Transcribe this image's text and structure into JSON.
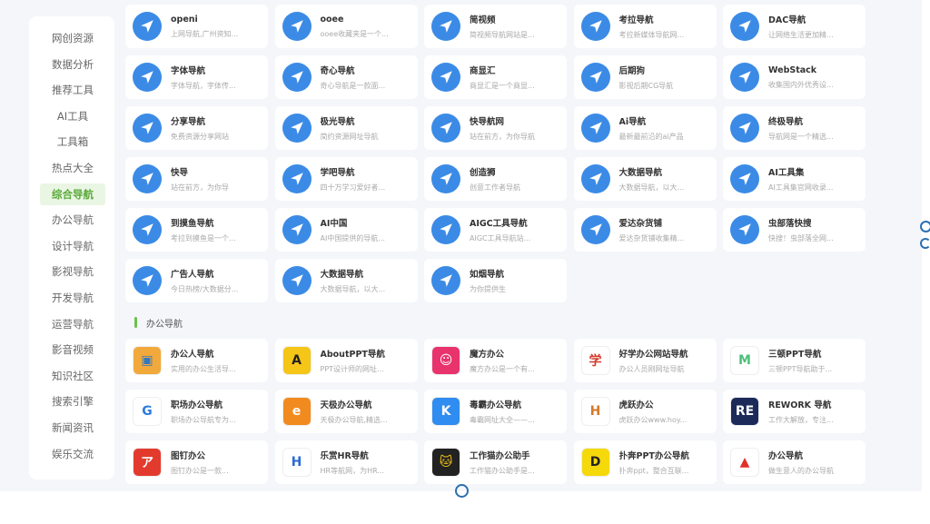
{
  "sidebar": {
    "items": [
      {
        "label": "网创资源"
      },
      {
        "label": "数据分析"
      },
      {
        "label": "推荐工具"
      },
      {
        "label": "AI工具"
      },
      {
        "label": "工具箱"
      },
      {
        "label": "热点大全"
      },
      {
        "label": "综合导航",
        "active": true
      },
      {
        "label": "办公导航"
      },
      {
        "label": "设计导航"
      },
      {
        "label": "影视导航"
      },
      {
        "label": "开发导航"
      },
      {
        "label": "运营导航"
      },
      {
        "label": "影音视频"
      },
      {
        "label": "知识社区"
      },
      {
        "label": "搜索引擎"
      },
      {
        "label": "新闻资讯"
      },
      {
        "label": "娱乐交流"
      }
    ]
  },
  "general_nav": {
    "cards": [
      {
        "title": "openi",
        "desc": "上网导航,广州资知..."
      },
      {
        "title": "ooee",
        "desc": "ooee收藏夹是一个..."
      },
      {
        "title": "简视频",
        "desc": "简视频导航网站是..."
      },
      {
        "title": "考拉导航",
        "desc": "考拉新媒体导航网..."
      },
      {
        "title": "DAC导航",
        "desc": "让网络生活更加精..."
      },
      {
        "title": "字体导航",
        "desc": "字体导航，字体传..."
      },
      {
        "title": "奇心导航",
        "desc": "奇心导航是一款面..."
      },
      {
        "title": "商显汇",
        "desc": "商显汇是一个商显..."
      },
      {
        "title": "后期狗",
        "desc": "影视后期CG导航"
      },
      {
        "title": "WebStack",
        "desc": "收集国内外优秀设..."
      },
      {
        "title": "分享导航",
        "desc": "免费资源分享网站"
      },
      {
        "title": "极光导航",
        "desc": "简约资源网址导航"
      },
      {
        "title": "快导航网",
        "desc": "站在前方，为你导航"
      },
      {
        "title": "Ai导航",
        "desc": "最新最前沿的ai产品"
      },
      {
        "title": "终极导航",
        "desc": "导航网是一个精选..."
      },
      {
        "title": "快导",
        "desc": "站在前方，为你导"
      },
      {
        "title": "学吧导航",
        "desc": "四十万学习爱好者..."
      },
      {
        "title": "创造狮",
        "desc": "创意工作者导航"
      },
      {
        "title": "大数据导航",
        "desc": "大数据导航，以大..."
      },
      {
        "title": "AI工具集",
        "desc": "AI工具集官网收录..."
      },
      {
        "title": "到摸鱼导航",
        "desc": "考拉到摸鱼是一个..."
      },
      {
        "title": "AI中国",
        "desc": "AI中国提供的导航..."
      },
      {
        "title": "AIGC工具导航",
        "desc": "AIGC工具导航站..."
      },
      {
        "title": "爱达杂货铺",
        "desc": "爱达杂货铺收集精..."
      },
      {
        "title": "虫部落快搜",
        "desc": "快搜！虫部落全网..."
      },
      {
        "title": "广告人导航",
        "desc": "今日热榜/大数据分..."
      },
      {
        "title": "大数据导航",
        "desc": "大数据导航，以大..."
      },
      {
        "title": "如烟导航",
        "desc": "为你提供生"
      }
    ]
  },
  "office_nav": {
    "section_title": "办公导航",
    "cards": [
      {
        "title": "办公人导航",
        "desc": "实用的办公生活导...",
        "logo_bg": "#f2a93b",
        "logo_fg": "#2f78c4",
        "glyph": "▣"
      },
      {
        "title": "AboutPPT导航",
        "desc": "PPT设计师的网址...",
        "logo_bg": "#f5c518",
        "logo_fg": "#222222",
        "glyph": "A"
      },
      {
        "title": "魔方办公",
        "desc": "魔方办公是一个有...",
        "logo_bg": "#e8336d",
        "logo_fg": "#ffffff",
        "glyph": "☺"
      },
      {
        "title": "好学办公网站导航",
        "desc": "办公人员刚网址导航",
        "logo_bg": "#ffffff",
        "logo_fg": "#d33a2c",
        "glyph": "学"
      },
      {
        "title": "三顿PPT导航",
        "desc": "三顿PPT导航助于...",
        "logo_bg": "#ffffff",
        "logo_fg": "#4cbf7a",
        "glyph": "M"
      },
      {
        "title": "职场办公导航",
        "desc": "职场办公导航专为...",
        "logo_bg": "#ffffff",
        "logo_fg": "#2d7be0",
        "glyph": "G"
      },
      {
        "title": "天极办公导航",
        "desc": "天极办公导航,精选...",
        "logo_bg": "#f28b1f",
        "logo_fg": "#ffffff",
        "glyph": "e"
      },
      {
        "title": "毒霸办公导航",
        "desc": "毒霸网址大全——...",
        "logo_bg": "#2f8cf0",
        "logo_fg": "#ffffff",
        "glyph": "K"
      },
      {
        "title": "虎跃办公",
        "desc": "虎跃办公www.hoy...",
        "logo_bg": "#ffffff",
        "logo_fg": "#d5792a",
        "glyph": "H"
      },
      {
        "title": "REWORK 导航",
        "desc": "工作大解放，专注...",
        "logo_bg": "#1c2a5a",
        "logo_fg": "#ffffff",
        "glyph": "RE"
      },
      {
        "title": "图钉办公",
        "desc": "图钉办公是一款...",
        "logo_bg": "#e23b2e",
        "logo_fg": "#ffffff",
        "glyph": "ア"
      },
      {
        "title": "乐赏HR导航",
        "desc": "HR等航网，为HR...",
        "logo_bg": "#ffffff",
        "logo_fg": "#2d6bd1",
        "glyph": "H"
      },
      {
        "title": "工作猫办公助手",
        "desc": "工作猫办公助手是...",
        "logo_bg": "#222222",
        "logo_fg": "#f5c518",
        "glyph": "🐱"
      },
      {
        "title": "扑奔PPT办公导航",
        "desc": "扑奔ppt，整合互联...",
        "logo_bg": "#f5d90a",
        "logo_fg": "#222222",
        "glyph": "D"
      },
      {
        "title": "办公导航",
        "desc": "做生意人的办公导航",
        "logo_bg": "#ffffff",
        "logo_fg": "#e0312a",
        "glyph": "▲"
      }
    ]
  }
}
